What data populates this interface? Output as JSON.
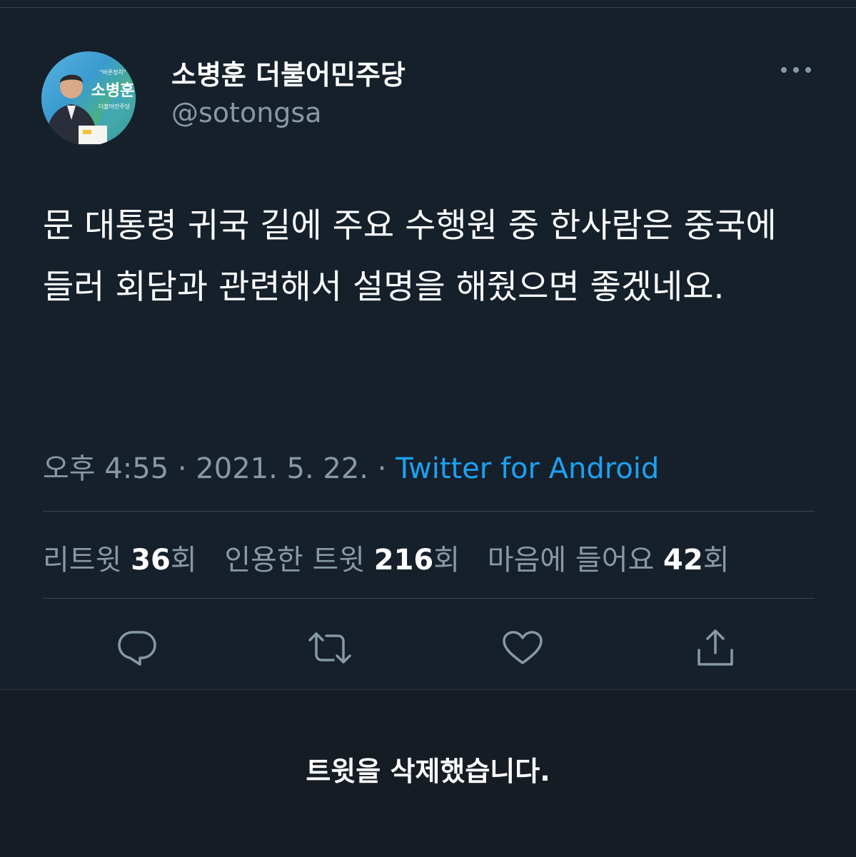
{
  "user": {
    "display_name": "소병훈 더불어민주당",
    "handle": "@sotongsa",
    "avatar_tagline": "\"바른정치\"",
    "avatar_name": "소병훈",
    "avatar_party": "더불어민주당"
  },
  "tweet": {
    "text": "문 대통령 귀국 길에 주요 수행원 중 한사람은 중국에 들러 회담과 관련해서 설명을 해줬으면 좋겠네요.",
    "time": "오후 4:55",
    "date": "2021. 5. 22.",
    "separator": "·",
    "source": "Twitter for Android"
  },
  "stats": {
    "retweets_label": "리트윗",
    "retweets_count": "36",
    "quotes_label": "인용한 트윗",
    "quotes_count": "216",
    "likes_label": "마음에 들어요",
    "likes_count": "42",
    "unit": "회"
  },
  "actions": {
    "reply_icon": "reply-icon",
    "retweet_icon": "retweet-icon",
    "like_icon": "heart-icon",
    "share_icon": "share-icon"
  },
  "notice": {
    "deleted": "트윗을 삭제했습니다."
  },
  "colors": {
    "background": "#15202b",
    "muted": "#8899a6",
    "link": "#1da1f2",
    "divider": "#38444d"
  }
}
